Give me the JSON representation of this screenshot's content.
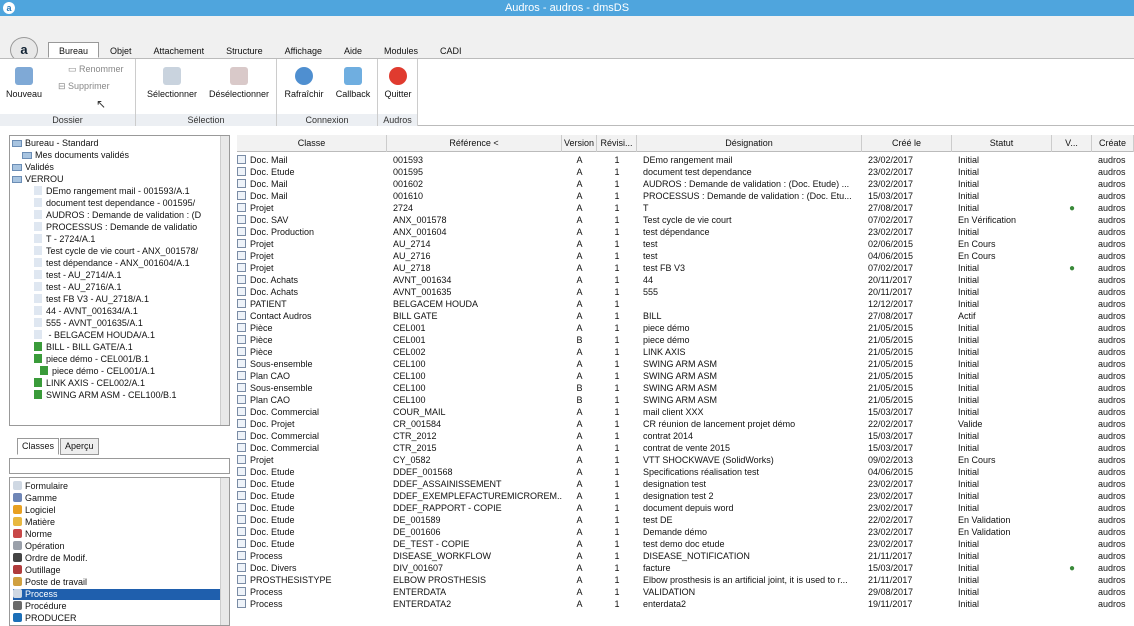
{
  "window": {
    "title": "Audros - audros - dmsDS"
  },
  "tabs": [
    "Bureau",
    "Objet",
    "Attachement",
    "Structure",
    "Affichage",
    "Aide",
    "Modules",
    "CADI"
  ],
  "ribbon": {
    "dossier": {
      "name": "Dossier",
      "nouveau": "Nouveau",
      "renommer": "Renommer",
      "supprimer": "Supprimer"
    },
    "selection": {
      "name": "Sélection",
      "selectionner": "Sélectionner",
      "deselectionner": "Désélectionner"
    },
    "connexion": {
      "name": "Connexion",
      "rafraichir": "Rafraîchir",
      "callback": "Callback"
    },
    "audros": {
      "name": "Audros",
      "quitter": "Quitter"
    }
  },
  "tree": [
    "Bureau - Standard",
    "Mes documents validés",
    "Validés",
    "VERROU",
    "DEmo rangement mail - 001593/A.1",
    "document test dependance - 001595/",
    "AUDROS : Demande de validation : (D",
    "PROCESSUS : Demande de validatio",
    "T - 2724/A.1",
    "Test cycle de vie court - ANX_001578/",
    "test dépendance - ANX_001604/A.1",
    "test - AU_2714/A.1",
    "test - AU_2716/A.1",
    "test FB V3 - AU_2718/A.1",
    "44 - AVNT_001634/A.1",
    "555 - AVNT_001635/A.1",
    " - BELGACEM HOUDA/A.1",
    "BILL - BILL GATE/A.1",
    "piece démo - CEL001/B.1",
    "piece démo - CEL001/A.1",
    "LINK AXIS - CEL002/A.1",
    "SWING ARM ASM - CEL100/B.1"
  ],
  "lower_tabs": [
    "Classes",
    "Aperçu"
  ],
  "classes": [
    "Formulaire",
    "Gamme",
    "Logiciel",
    "Matière",
    "Norme",
    "Opération",
    "Ordre de Modif.",
    "Outillage",
    "Poste de travail",
    "Process",
    "Procédure",
    "PRODUCER"
  ],
  "grid": {
    "headers": [
      "Classe",
      "Référence <",
      "Version",
      "Révisi...",
      "Désignation",
      "Créé le",
      "Statut",
      "V...",
      "Créate"
    ],
    "rows": [
      [
        "Doc. Mail",
        "001593",
        "A",
        "1",
        "DEmo rangement mail",
        "23/02/2017",
        "Initial",
        "",
        "audros"
      ],
      [
        "Doc. Etude",
        "001595",
        "A",
        "1",
        "document test dependance",
        "23/02/2017",
        "Initial",
        "",
        "audros"
      ],
      [
        "Doc. Mail",
        "001602",
        "A",
        "1",
        "AUDROS : Demande de validation : (Doc. Etude) ...",
        "23/02/2017",
        "Initial",
        "",
        "audros"
      ],
      [
        "Doc. Mail",
        "001610",
        "A",
        "1",
        "PROCESSUS : Demande de validation : (Doc. Etu...",
        "15/03/2017",
        "Initial",
        "",
        "audros"
      ],
      [
        "Projet",
        "2724",
        "A",
        "1",
        "T",
        "27/08/2017",
        "Initial",
        "x",
        "audros"
      ],
      [
        "Doc. SAV",
        "ANX_001578",
        "A",
        "1",
        "Test cycle de vie court",
        "07/02/2017",
        "En Vérification",
        "",
        "audros"
      ],
      [
        "Doc. Production",
        "ANX_001604",
        "A",
        "1",
        "test dépendance",
        "23/02/2017",
        "Initial",
        "",
        "audros"
      ],
      [
        "Projet",
        "AU_2714",
        "A",
        "1",
        "test",
        "02/06/2015",
        "En Cours",
        "",
        "audros"
      ],
      [
        "Projet",
        "AU_2716",
        "A",
        "1",
        "test",
        "04/06/2015",
        "En Cours",
        "",
        "audros"
      ],
      [
        "Projet",
        "AU_2718",
        "A",
        "1",
        "test FB V3",
        "07/02/2017",
        "Initial",
        "x",
        "audros"
      ],
      [
        "Doc. Achats",
        "AVNT_001634",
        "A",
        "1",
        "44",
        "20/11/2017",
        "Initial",
        "",
        "audros"
      ],
      [
        "Doc. Achats",
        "AVNT_001635",
        "A",
        "1",
        "555",
        "20/11/2017",
        "Initial",
        "",
        "audros"
      ],
      [
        "PATIENT",
        "BELGACEM HOUDA",
        "A",
        "1",
        "",
        "12/12/2017",
        "Initial",
        "",
        "audros"
      ],
      [
        "Contact Audros",
        "BILL GATE",
        "A",
        "1",
        "BILL",
        "27/08/2017",
        "Actif",
        "",
        "audros"
      ],
      [
        "Pièce",
        "CEL001",
        "A",
        "1",
        "piece démo",
        "21/05/2015",
        "Initial",
        "",
        "audros"
      ],
      [
        "Pièce",
        "CEL001",
        "B",
        "1",
        "piece démo",
        "21/05/2015",
        "Initial",
        "",
        "audros"
      ],
      [
        "Pièce",
        "CEL002",
        "A",
        "1",
        "LINK AXIS",
        "21/05/2015",
        "Initial",
        "",
        "audros"
      ],
      [
        "Sous-ensemble",
        "CEL100",
        "A",
        "1",
        "SWING ARM ASM",
        "21/05/2015",
        "Initial",
        "",
        "audros"
      ],
      [
        "Plan CAO",
        "CEL100",
        "A",
        "1",
        "SWING ARM ASM",
        "21/05/2015",
        "Initial",
        "",
        "audros"
      ],
      [
        "Sous-ensemble",
        "CEL100",
        "B",
        "1",
        "SWING ARM ASM",
        "21/05/2015",
        "Initial",
        "",
        "audros"
      ],
      [
        "Plan CAO",
        "CEL100",
        "B",
        "1",
        "SWING ARM ASM",
        "21/05/2015",
        "Initial",
        "",
        "audros"
      ],
      [
        "Doc. Commercial",
        "COUR_MAIL",
        "A",
        "1",
        "mail client XXX",
        "15/03/2017",
        "Initial",
        "",
        "audros"
      ],
      [
        "Doc. Projet",
        "CR_001584",
        "A",
        "1",
        "CR réunion de lancement projet démo",
        "22/02/2017",
        "Valide",
        "",
        "audros"
      ],
      [
        "Doc. Commercial",
        "CTR_2012",
        "A",
        "1",
        "contrat 2014",
        "15/03/2017",
        "Initial",
        "",
        "audros"
      ],
      [
        "Doc. Commercial",
        "CTR_2015",
        "A",
        "1",
        "contrat de vente 2015",
        "15/03/2017",
        "Initial",
        "",
        "audros"
      ],
      [
        "Projet",
        "CY_0582",
        "A",
        "1",
        "VTT SHOCKWAVE (SolidWorks)",
        "09/02/2013",
        "En Cours",
        "",
        "audros"
      ],
      [
        "Doc. Etude",
        "DDEF_001568",
        "A",
        "1",
        "Specifications réalisation test",
        "04/06/2015",
        "Initial",
        "",
        "audros"
      ],
      [
        "Doc. Etude",
        "DDEF_ASSAINISSEMENT",
        "A",
        "1",
        "designation test",
        "23/02/2017",
        "Initial",
        "",
        "audros"
      ],
      [
        "Doc. Etude",
        "DDEF_EXEMPLEFACTUREMICROREM...",
        "A",
        "1",
        "designation test 2",
        "23/02/2017",
        "Initial",
        "",
        "audros"
      ],
      [
        "Doc. Etude",
        "DDEF_RAPPORT - COPIE",
        "A",
        "1",
        "document depuis word",
        "23/02/2017",
        "Initial",
        "",
        "audros"
      ],
      [
        "Doc. Etude",
        "DE_001589",
        "A",
        "1",
        "test DE",
        "22/02/2017",
        "En Validation",
        "",
        "audros"
      ],
      [
        "Doc. Etude",
        "DE_001606",
        "A",
        "1",
        "Demande démo",
        "23/02/2017",
        "En Validation",
        "",
        "audros"
      ],
      [
        "Doc. Etude",
        "DE_TEST - COPIE",
        "A",
        "1",
        "test demo doc etude",
        "23/02/2017",
        "Initial",
        "",
        "audros"
      ],
      [
        "Process",
        "DISEASE_WORKFLOW",
        "A",
        "1",
        "DISEASE_NOTIFICATION",
        "21/11/2017",
        "Initial",
        "",
        "audros"
      ],
      [
        "Doc. Divers",
        "DIV_001607",
        "A",
        "1",
        "facture",
        "15/03/2017",
        "Initial",
        "x",
        "audros"
      ],
      [
        "PROSTHESISTYPE",
        "ELBOW PROSTHESIS",
        "A",
        "1",
        "Elbow prosthesis is an artificial joint, it is used to r...",
        "21/11/2017",
        "Initial",
        "",
        "audros"
      ],
      [
        "Process",
        "ENTERDATA",
        "A",
        "1",
        "VALIDATION",
        "29/08/2017",
        "Initial",
        "",
        "audros"
      ],
      [
        "Process",
        "ENTERDATA2",
        "A",
        "1",
        "enterdata2",
        "19/11/2017",
        "Initial",
        "",
        "audros"
      ]
    ]
  }
}
